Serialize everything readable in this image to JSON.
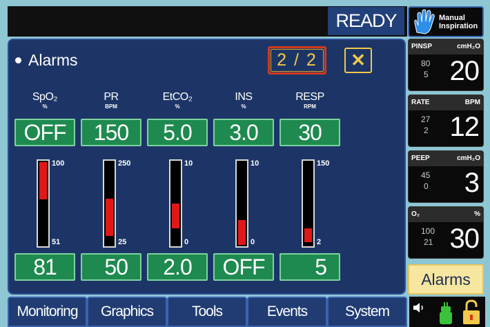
{
  "header": {
    "status": "READY",
    "manual_button": {
      "line1": "Manual",
      "line2": "Inspiration",
      "icon": "hand-icon"
    }
  },
  "alarms_panel": {
    "title": "Alarms",
    "page_indicator": "2 / 2",
    "close_label": "✕",
    "parameters": [
      {
        "label": "SpO₂",
        "unit": "%",
        "high": "OFF",
        "low": "81",
        "bar_max": "100",
        "bar_min": "51",
        "bar_fill": {
          "from": 0.55,
          "to": 1.0
        }
      },
      {
        "label": "PR",
        "unit": "BPM",
        "high": "150",
        "low": "50",
        "bar_max": "250",
        "bar_min": "25",
        "bar_fill": {
          "from": 0.11,
          "to": 0.56
        }
      },
      {
        "label": "EtCO₂",
        "unit": "%",
        "high": "5.0",
        "low": "2.0",
        "bar_max": "10",
        "bar_min": "0",
        "bar_fill": {
          "from": 0.2,
          "to": 0.5
        }
      },
      {
        "label": "INS",
        "unit": "%",
        "high": "3.0",
        "low": "OFF",
        "bar_max": "10",
        "bar_min": "0",
        "bar_fill": {
          "from": 0.0,
          "to": 0.3
        }
      },
      {
        "label": "RESP",
        "unit": "RPM",
        "high": "30",
        "low": "5",
        "bar_max": "150",
        "bar_min": "2",
        "bar_fill": {
          "from": 0.03,
          "to": 0.2
        }
      }
    ]
  },
  "side_panel": {
    "cards": [
      {
        "name": "PINSP",
        "unit": "cmH₂O",
        "high": "80",
        "low": "5",
        "value": "20"
      },
      {
        "name": "RATE",
        "unit": "BPM",
        "high": "27",
        "low": "2",
        "value": "12"
      },
      {
        "name": "PEEP",
        "unit": "cmH₂O",
        "high": "45",
        "low": "0",
        "value": "3"
      },
      {
        "name": "O₂",
        "unit": "%",
        "high": "100",
        "low": "21",
        "value": "30"
      }
    ],
    "alarms_button": "Alarms"
  },
  "tabs": [
    "Monitoring",
    "Graphics",
    "Tools",
    "Events",
    "System"
  ],
  "status_icons": [
    "speaker-icon",
    "battery-plug-icon",
    "lock-icon"
  ],
  "colors": {
    "panel_bg": "#1d3566",
    "setting_box": "#1e8a4f",
    "bar_fill": "#e01818",
    "highlight": "#f2c94c",
    "alarms_button": "#f7e6a0"
  }
}
